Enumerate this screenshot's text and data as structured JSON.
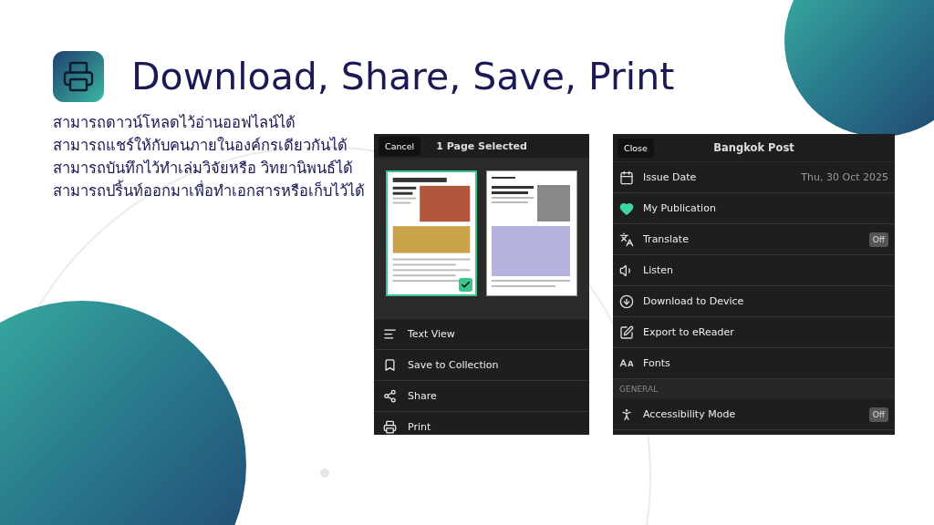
{
  "slide": {
    "title": "Download, Share, Save, Print",
    "bullets": [
      "สามารถดาวน์โหลดไว้อ่านออฟไลน์ได้",
      "สามารถแชร์ให้กับคนภายในองค์กรเดียวกันได้",
      "สามารถบันทึกไว้ทำเล่มวิจัยหรือ วิทยานิพนธ์ได้",
      "สามารถปริ้นท์ออกมาเพื่อทำเอกสารหรือเก็บไว้ได้"
    ]
  },
  "selection_screen": {
    "cancel": "Cancel",
    "title": "1 Page Selected",
    "pages": [
      {
        "selected": true
      },
      {
        "selected": false
      }
    ],
    "actions": [
      "Text View",
      "Save to Collection",
      "Share",
      "Print"
    ]
  },
  "options_screen": {
    "close": "Close",
    "title": "Bangkok Post",
    "rows": [
      {
        "kind": "item",
        "label": "Issue Date",
        "value": "Thu, 30 Oct 2025"
      },
      {
        "kind": "item",
        "label": "My Publication"
      },
      {
        "kind": "item",
        "label": "Translate",
        "toggle": "Off"
      },
      {
        "kind": "item",
        "label": "Listen"
      },
      {
        "kind": "item",
        "label": "Download to Device"
      },
      {
        "kind": "item",
        "label": "Export to eReader"
      },
      {
        "kind": "item",
        "label": "Fonts"
      },
      {
        "kind": "section",
        "label": "GENERAL"
      },
      {
        "kind": "item",
        "label": "Accessibility Mode",
        "toggle": "Off"
      }
    ]
  }
}
